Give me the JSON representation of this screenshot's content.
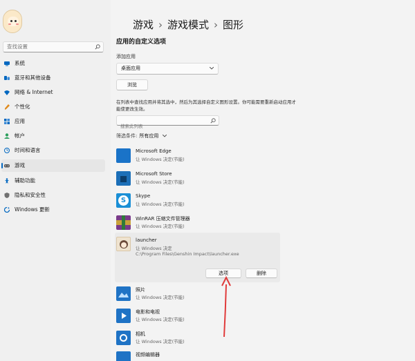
{
  "breadcrumb": {
    "items": [
      "游戏",
      "游戏模式",
      "图形"
    ],
    "separator": "›"
  },
  "sidebar": {
    "search_placeholder": "查找设置",
    "items": [
      {
        "label": "系统",
        "icon": "system-icon",
        "color": "#0067c0"
      },
      {
        "label": "蓝牙和其他设备",
        "icon": "bluetooth-icon",
        "color": "#0067c0"
      },
      {
        "label": "网络 & Internet",
        "icon": "network-icon",
        "color": "#0067c0"
      },
      {
        "label": "个性化",
        "icon": "personalization-icon",
        "color": "#e08a1c"
      },
      {
        "label": "应用",
        "icon": "apps-icon",
        "color": "#0067c0"
      },
      {
        "label": "帐户",
        "icon": "accounts-icon",
        "color": "#2b9e5c"
      },
      {
        "label": "时间和语言",
        "icon": "time-language-icon",
        "color": "#0067c0"
      },
      {
        "label": "游戏",
        "icon": "gaming-icon",
        "color": "#555555",
        "active": true
      },
      {
        "label": "辅助功能",
        "icon": "accessibility-icon",
        "color": "#0067c0"
      },
      {
        "label": "隐私和安全性",
        "icon": "privacy-icon",
        "color": "#707070"
      },
      {
        "label": "Windows 更新",
        "icon": "windows-update-icon",
        "color": "#0067c0"
      }
    ]
  },
  "custom": {
    "heading": "应用的自定义选项",
    "add_app_label": "添加应用",
    "app_type_selected": "桌面应用",
    "browse_label": "浏览",
    "description": "在列表中查找应用并将其选中，然后为其选择自定义图形设置。你可能需要重新启动应用才能使更改生效。",
    "list_search_placeholder": "搜索此列表",
    "filter_label": "筛选条件:",
    "filter_value": "所有应用"
  },
  "apps": [
    {
      "name": "Microsoft Edge",
      "pref": "让 Windows 决定(节能)",
      "icon": "edge-icon",
      "color": "#1a73c8"
    },
    {
      "name": "Microsoft Store",
      "pref": "让 Windows 决定(节能)",
      "icon": "store-icon",
      "color": "#1c6fb8"
    },
    {
      "name": "Skype",
      "pref": "让 Windows 决定(节能)",
      "icon": "skype-icon",
      "color": "#1a8fd6"
    },
    {
      "name": "WinRAR 压缩文件管理器",
      "pref": "让 Windows 决定(节能)",
      "icon": "winrar-icon",
      "color": "#7a3a8a"
    },
    {
      "name": "launcher",
      "pref": "让 Windows 决定",
      "path": "C:\\Program Files\\Genshin Impact\\launcher.exe",
      "icon": "genshin-launcher-icon",
      "color": "#efe3cf"
    },
    {
      "name": "照片",
      "pref": "让 Windows 决定(节能)",
      "icon": "photos-icon",
      "color": "#1f73c5"
    },
    {
      "name": "电影和电视",
      "pref": "让 Windows 决定(节能)",
      "icon": "movies-tv-icon",
      "color": "#1f73c5"
    },
    {
      "name": "相机",
      "pref": "让 Windows 决定(节能)",
      "icon": "camera-icon",
      "color": "#1f73c5"
    },
    {
      "name": "视频编辑器",
      "pref": "",
      "icon": "video-editor-icon",
      "color": "#1f73c5"
    }
  ],
  "expanded_actions": {
    "options_label": "选项",
    "remove_label": "删除"
  },
  "annotation": {
    "arrow_color": "#e03a3a"
  }
}
